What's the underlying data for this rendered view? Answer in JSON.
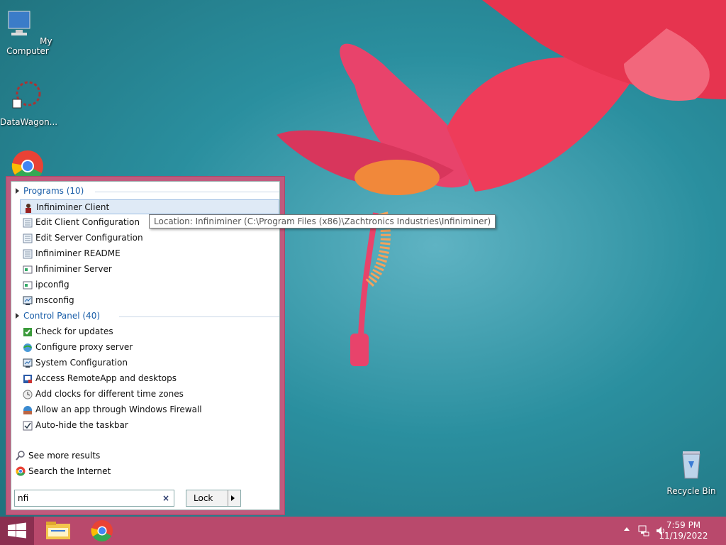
{
  "desktop": {
    "icons": [
      {
        "label": "My Computer",
        "icon": "my-computer-icon"
      },
      {
        "label": "DataWagon...",
        "icon": "datawagon-icon"
      },
      {
        "label": "",
        "icon": "chrome-icon"
      },
      {
        "label": "Recycle Bin",
        "icon": "recycle-bin-icon"
      }
    ]
  },
  "start_menu": {
    "groups": [
      {
        "label": "Programs (10)"
      },
      {
        "label": "Control Panel (40)"
      }
    ],
    "programs": [
      {
        "label": "Infiniminer Client",
        "icon": "infiniminer-icon"
      },
      {
        "label": "Edit Client Configuration",
        "icon": "text-file-icon"
      },
      {
        "label": "Edit Server Configuration",
        "icon": "text-file-icon"
      },
      {
        "label": "Infiniminer README",
        "icon": "text-file-icon"
      },
      {
        "label": "Infiniminer Server",
        "icon": "app-window-icon"
      },
      {
        "label": "ipconfig",
        "icon": "app-window-icon"
      },
      {
        "label": "msconfig",
        "icon": "system-config-icon"
      }
    ],
    "control_panel": [
      {
        "label": "Check for updates",
        "icon": "windows-update-icon"
      },
      {
        "label": "Configure proxy server",
        "icon": "internet-options-icon"
      },
      {
        "label": "System Configuration",
        "icon": "system-config-icon"
      },
      {
        "label": "Access RemoteApp and desktops",
        "icon": "remoteapp-icon"
      },
      {
        "label": "Add clocks for different time zones",
        "icon": "clock-icon"
      },
      {
        "label": "Allow an app through Windows Firewall",
        "icon": "firewall-icon"
      },
      {
        "label": "Auto-hide the taskbar",
        "icon": "taskbar-settings-icon"
      }
    ],
    "see_more": "See more results",
    "search_internet": "Search the Internet",
    "search_value": "nfi",
    "clear_label": "×",
    "lock_label": "Lock"
  },
  "tooltip": "Location: Infiniminer (C:\\Program Files (x86)\\Zachtronics Industries\\Infiniminer)",
  "taskbar": {
    "time": "7:59 PM",
    "date": "11/19/2022"
  }
}
